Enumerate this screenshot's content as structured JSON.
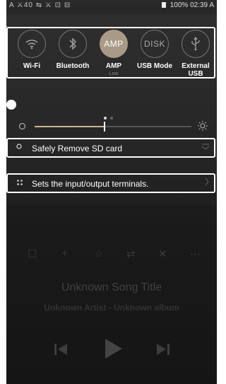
{
  "status_bar": {
    "left": "A ⚔40 ⇆ ⚔ ⊡ ⊟",
    "battery": "100%",
    "time": "02:39 A"
  },
  "quick_settings": [
    {
      "label": "Wi-Fi",
      "icon": "wifi-icon",
      "active": false
    },
    {
      "label": "Bluetooth",
      "icon": "bluetooth-icon",
      "active": false
    },
    {
      "label": "AMP",
      "icon": "amp-icon",
      "active": true,
      "sublabel": "Low"
    },
    {
      "label": "USB Mode",
      "icon": "disk-icon",
      "active": false
    },
    {
      "label": "External\nUSB",
      "icon": "usb-icon",
      "active": false
    }
  ],
  "amp_circle_text": "AMP",
  "disk_circle_text": "DISK",
  "page_indicator": {
    "total": 2,
    "current": 1
  },
  "brightness": {
    "level": 0.44
  },
  "sd_card": {
    "label": "Safely Remove SD card"
  },
  "io_terminals": {
    "label": "Sets the input/output terminals."
  },
  "player": {
    "song_title": "Unknown Song Title",
    "artist_album": "Unknown Artist - Unknown album"
  },
  "colors": {
    "accent": "#a99a87",
    "brightness_fill": "#cbb58f",
    "highlight": "#ffffff"
  }
}
